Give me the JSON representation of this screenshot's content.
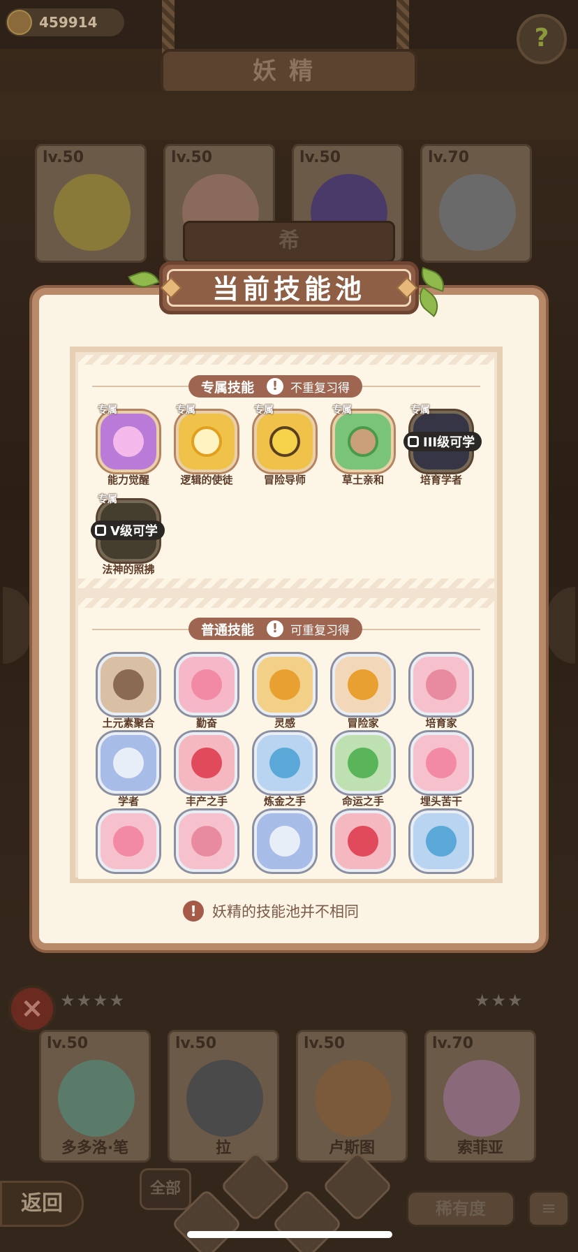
{
  "top": {
    "coins": "459914",
    "help_icon": "question-leaf-icon",
    "section_title": "妖精"
  },
  "bg_cards_top": [
    {
      "level": "lv.50"
    },
    {
      "level": "lv.50"
    },
    {
      "level": "lv.50"
    },
    {
      "level": "lv.70"
    }
  ],
  "header_sign": "希",
  "modal": {
    "title": "当前技能池",
    "exclusive": {
      "header": "专属技能",
      "note": "不重复习得",
      "tag": "专属",
      "skills": [
        {
          "name": "能力觉醒",
          "color": "#b97ad8"
        },
        {
          "name": "逻辑的使徒",
          "color": "#f0c24a"
        },
        {
          "name": "冒险导师",
          "color": "#f0c24a"
        },
        {
          "name": "草土亲和",
          "color": "#7ac47a"
        },
        {
          "name": "培育学者",
          "color": "#6a6a8a",
          "lock": "III级可学"
        },
        {
          "name": "法神的照拂",
          "color": "#8a7a5a",
          "lock": "V级可学"
        }
      ]
    },
    "common": {
      "header": "普通技能",
      "note": "可重复习得",
      "skills": [
        {
          "name": "土元素聚合",
          "color": "#8a6a50"
        },
        {
          "name": "勤奋",
          "color": "#f28aa6"
        },
        {
          "name": "灵感",
          "color": "#e8a030"
        },
        {
          "name": "冒险家",
          "color": "#e8a030"
        },
        {
          "name": "培育家",
          "color": "#e88aa0"
        },
        {
          "name": "学者",
          "color": "#7a9ad8"
        },
        {
          "name": "丰产之手",
          "color": "#e04a5a"
        },
        {
          "name": "炼金之手",
          "color": "#5aa8d8"
        },
        {
          "name": "命运之手",
          "color": "#5ab45a"
        },
        {
          "name": "埋头苦干",
          "color": "#f28aa6"
        },
        {
          "name": "",
          "color": "#f28aa6"
        },
        {
          "name": "",
          "color": "#e88aa0"
        },
        {
          "name": "",
          "color": "#7a9ad8"
        },
        {
          "name": "",
          "color": "#e04a5a"
        },
        {
          "name": "",
          "color": "#5aa8d8"
        }
      ]
    },
    "notice": "妖精的技能池并不相同"
  },
  "bg_cards_bottom": [
    {
      "level": "lv.50",
      "name": "多多洛·笔"
    },
    {
      "level": "lv.50",
      "name": "拉"
    },
    {
      "level": "lv.50",
      "name": "卢斯图"
    },
    {
      "level": "lv.70",
      "name": "索菲亚"
    }
  ],
  "bottom": {
    "back": "返回",
    "filter_all": "全部",
    "rarity": "稀有度",
    "sort_icon": "sort-icon",
    "close_icon": "close-icon"
  }
}
